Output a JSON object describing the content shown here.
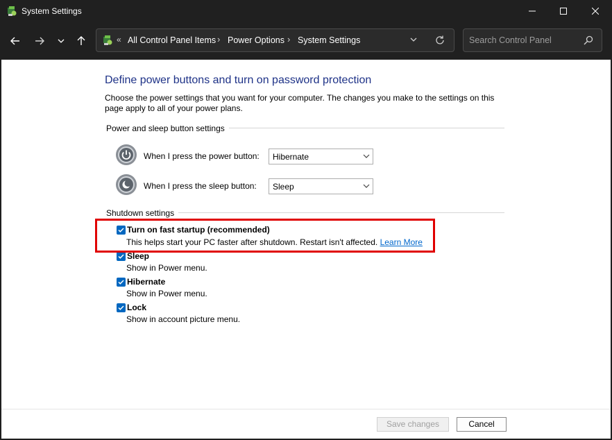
{
  "window": {
    "title": "System Settings"
  },
  "nav": {
    "breadcrumbs": [
      "All Control Panel Items",
      "Power Options",
      "System Settings"
    ],
    "search_placeholder": "Search Control Panel"
  },
  "page": {
    "heading": "Define power buttons and turn on password protection",
    "description": "Choose the power settings that you want for your computer. The changes you make to the settings on this page apply to all of your power plans."
  },
  "power_section": {
    "label": "Power and sleep button settings",
    "power_button": {
      "label": "When I press the power button:",
      "value": "Hibernate"
    },
    "sleep_button": {
      "label": "When I press the sleep button:",
      "value": "Sleep"
    }
  },
  "shutdown_section": {
    "label": "Shutdown settings",
    "items": [
      {
        "title": "Turn on fast startup (recommended)",
        "desc": "This helps start your PC faster after shutdown. Restart isn't affected.",
        "link": "Learn More",
        "checked": true
      },
      {
        "title": "Sleep",
        "desc": "Show in Power menu.",
        "checked": true
      },
      {
        "title": "Hibernate",
        "desc": "Show in Power menu.",
        "checked": true
      },
      {
        "title": "Lock",
        "desc": "Show in account picture menu.",
        "checked": true
      }
    ]
  },
  "footer": {
    "save_label": "Save changes",
    "cancel_label": "Cancel"
  },
  "colors": {
    "heading": "#1e3287",
    "checkbox": "#0067c0",
    "highlight": "#e00000",
    "link": "#0066cc"
  }
}
